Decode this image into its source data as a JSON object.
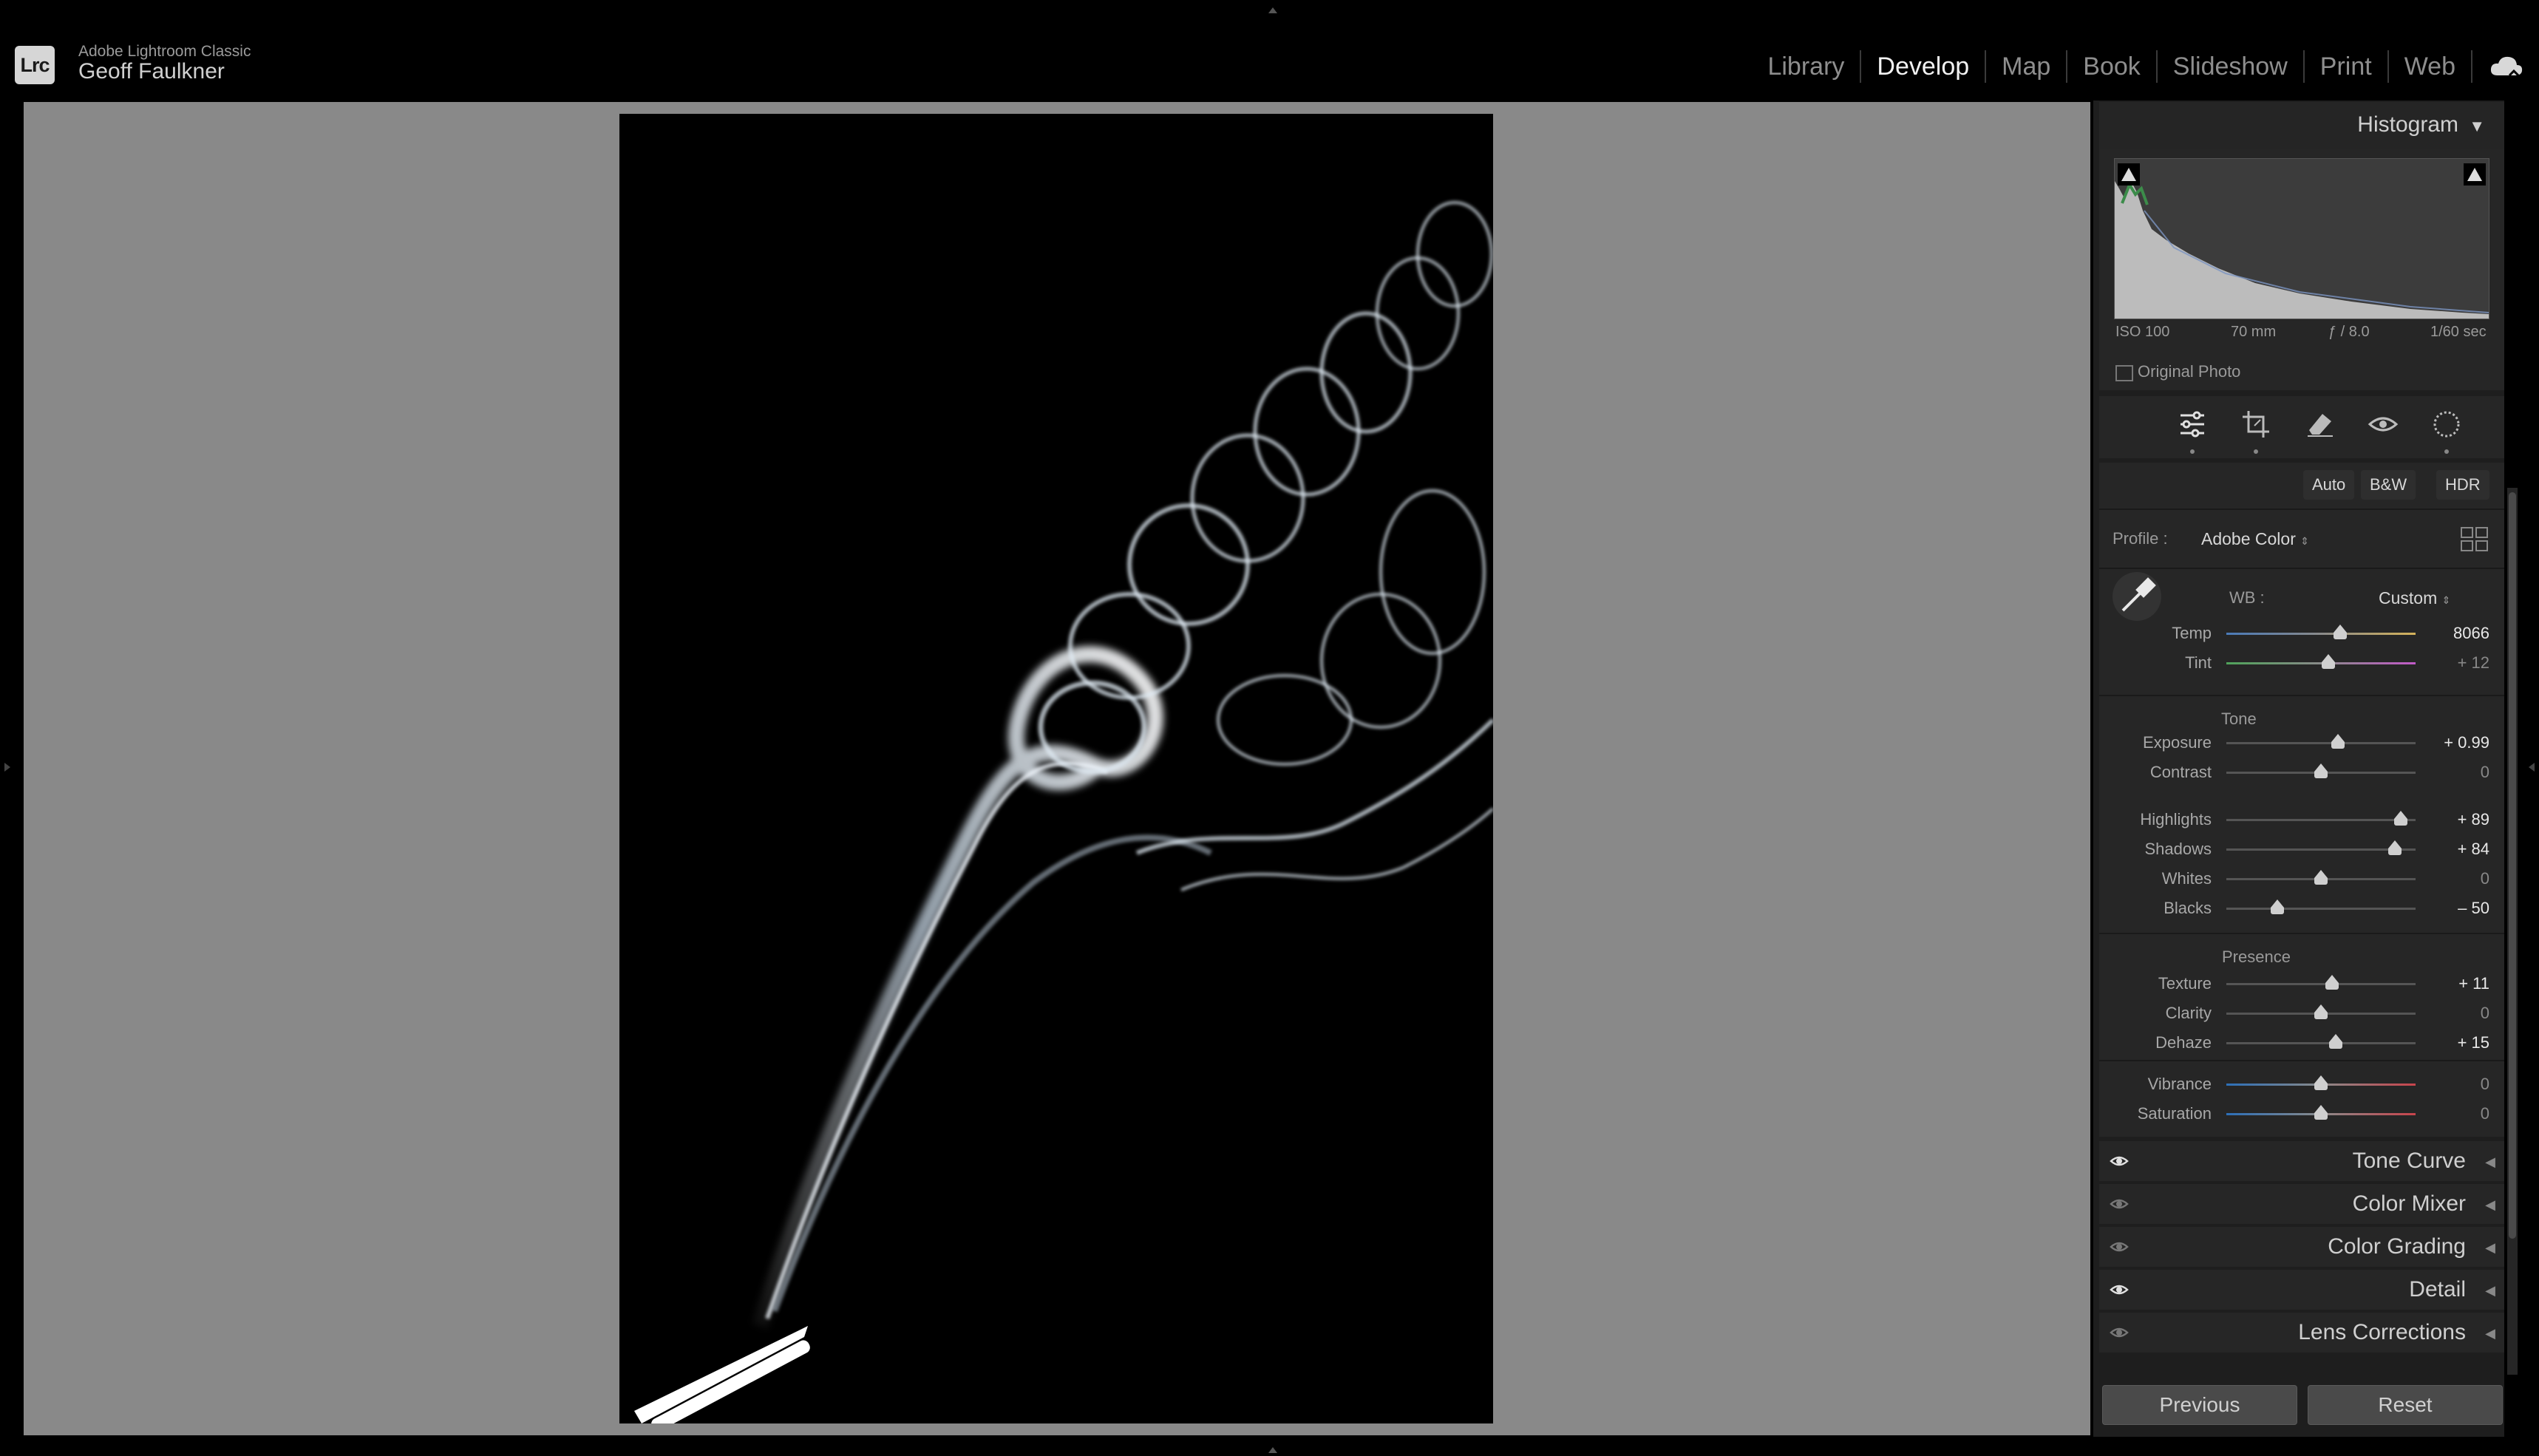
{
  "app": {
    "name": "Adobe Lightroom Classic",
    "user": "Geoff Faulkner",
    "logo_text": "Lrc"
  },
  "modules": [
    {
      "label": "Library",
      "active": false
    },
    {
      "label": "Develop",
      "active": true
    },
    {
      "label": "Map",
      "active": false
    },
    {
      "label": "Book",
      "active": false
    },
    {
      "label": "Slideshow",
      "active": false
    },
    {
      "label": "Print",
      "active": false
    },
    {
      "label": "Web",
      "active": false
    }
  ],
  "histogram": {
    "title": "Histogram",
    "iso": "ISO 100",
    "focal": "70 mm",
    "aperture": "ƒ / 8.0",
    "shutter": "1/60 sec",
    "original_photo_label": "Original Photo"
  },
  "basic": {
    "buttons": {
      "auto": "Auto",
      "bw": "B&W",
      "hdr": "HDR"
    },
    "profile_label": "Profile :",
    "profile_value": "Adobe Color",
    "wb_label": "WB :",
    "wb_value": "Custom",
    "tone_label": "Tone",
    "presence_label": "Presence",
    "sliders": [
      {
        "label": "Temp",
        "value": "8066",
        "position": 0.6
      },
      {
        "label": "Tint",
        "value": "+ 12",
        "position": 0.54
      },
      {
        "label": "Exposure",
        "value": "+ 0.99",
        "position": 0.59
      },
      {
        "label": "Contrast",
        "value": "0",
        "position": 0.5
      },
      {
        "label": "Highlights",
        "value": "+ 89",
        "position": 0.92
      },
      {
        "label": "Shadows",
        "value": "+ 84",
        "position": 0.89
      },
      {
        "label": "Whites",
        "value": "0",
        "position": 0.5
      },
      {
        "label": "Blacks",
        "value": "– 50",
        "position": 0.27
      },
      {
        "label": "Texture",
        "value": "+ 11",
        "position": 0.56
      },
      {
        "label": "Clarity",
        "value": "0",
        "position": 0.5
      },
      {
        "label": "Dehaze",
        "value": "+ 15",
        "position": 0.58
      },
      {
        "label": "Vibrance",
        "value": "0",
        "position": 0.5
      },
      {
        "label": "Saturation",
        "value": "0",
        "position": 0.5
      }
    ]
  },
  "panels": [
    {
      "label": "Tone Curve",
      "eye_active": true
    },
    {
      "label": "Color Mixer",
      "eye_active": false
    },
    {
      "label": "Color Grading",
      "eye_active": false
    },
    {
      "label": "Detail",
      "eye_active": true
    },
    {
      "label": "Lens Corrections",
      "eye_active": false
    }
  ],
  "footer": {
    "previous": "Previous",
    "reset": "Reset"
  }
}
